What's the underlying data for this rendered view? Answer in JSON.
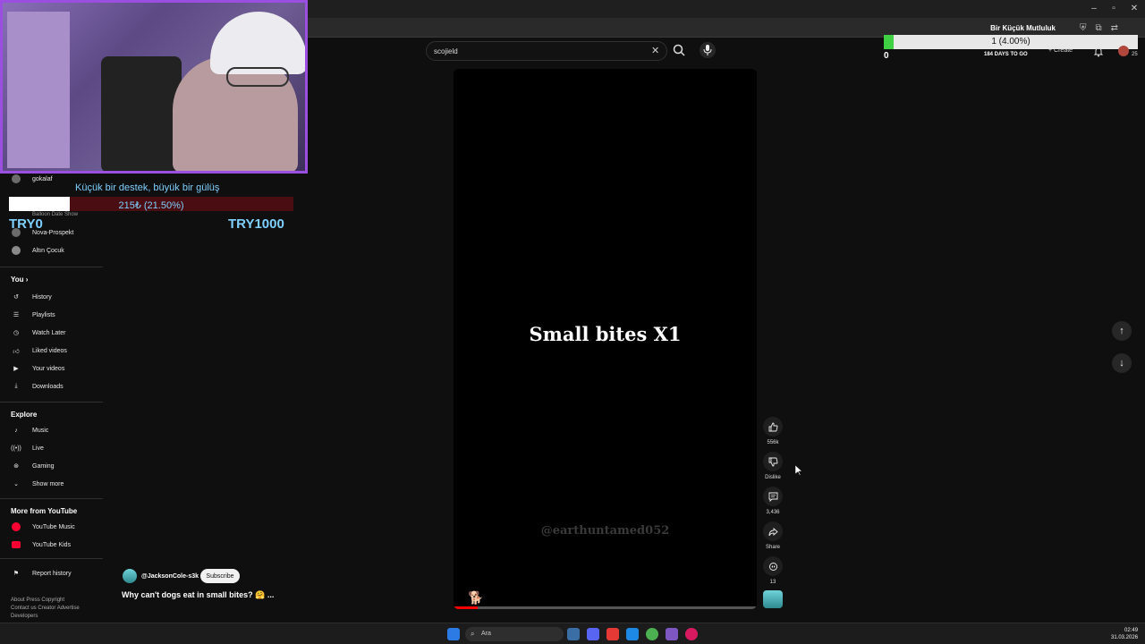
{
  "browser": {
    "controls": {
      "minimize": "–",
      "maximize": "▫",
      "close": "✕"
    }
  },
  "search": {
    "value": "scojield"
  },
  "stream_goal": {
    "title": "Bir Küçük Mutluluk",
    "progress_text": "1 (4.00%)",
    "progress": 0.04,
    "current": "0",
    "days_left": "184 DAYS TO GO"
  },
  "header": {
    "create_label": "Create",
    "notification_count": "25"
  },
  "donation": {
    "title": "Küçük bir destek, büyük bir gülüş",
    "progress_text": "215₺ (21.50%)",
    "progress": 0.215,
    "min": "TRY0",
    "max": "TRY1000"
  },
  "sidebar": {
    "subscriptions": [
      {
        "label": "gokalaf"
      },
      {
        "label": "Balloon Date Show"
      },
      {
        "label": "Nova-Prospekt"
      },
      {
        "label": "Altın Çocuk"
      }
    ],
    "you_title": "You",
    "you_items": [
      {
        "label": "History",
        "icon": "history-icon"
      },
      {
        "label": "Playlists",
        "icon": "playlists-icon"
      },
      {
        "label": "Watch Later",
        "icon": "clock-icon"
      },
      {
        "label": "Liked videos",
        "icon": "thumbs-up-icon"
      },
      {
        "label": "Your videos",
        "icon": "play-box-icon"
      },
      {
        "label": "Downloads",
        "icon": "download-icon"
      }
    ],
    "explore_title": "Explore",
    "explore_items": [
      {
        "label": "Music",
        "icon": "music-note-icon"
      },
      {
        "label": "Live",
        "icon": "live-icon"
      },
      {
        "label": "Gaming",
        "icon": "gamepad-icon"
      },
      {
        "label": "Show more",
        "icon": "chevron-down-icon"
      }
    ],
    "more_title": "More from YouTube",
    "more_items": [
      {
        "label": "YouTube Music",
        "icon": "youtube-music-icon"
      },
      {
        "label": "YouTube Kids",
        "icon": "youtube-kids-icon"
      }
    ],
    "report_history": "Report history",
    "footer": [
      "About",
      "Press",
      "Copyright",
      "Contact us",
      "Creator",
      "Advertise",
      "Developers"
    ]
  },
  "short": {
    "title": "Small bites X1",
    "watermark": "@earthuntamed052",
    "progress": 0.08,
    "channel": "@JacksonCole-s3k",
    "subscribe_label": "Subscribe",
    "caption": "Why can't dogs eat in small bites? 🤗 ..."
  },
  "actions": {
    "like_count": "556k",
    "dislike_label": "Dislike",
    "comment_count": "3,436",
    "share_label": "Share",
    "remix_count": "13"
  },
  "taskbar": {
    "search_label": "Ara",
    "time": "02:49",
    "date": "31.03.2026"
  },
  "colors": {
    "accent": "#ff0000",
    "webcam_border": "#9b4fe0",
    "overlay_text": "#7fd0ff",
    "goal_fill": "#3fd043"
  }
}
